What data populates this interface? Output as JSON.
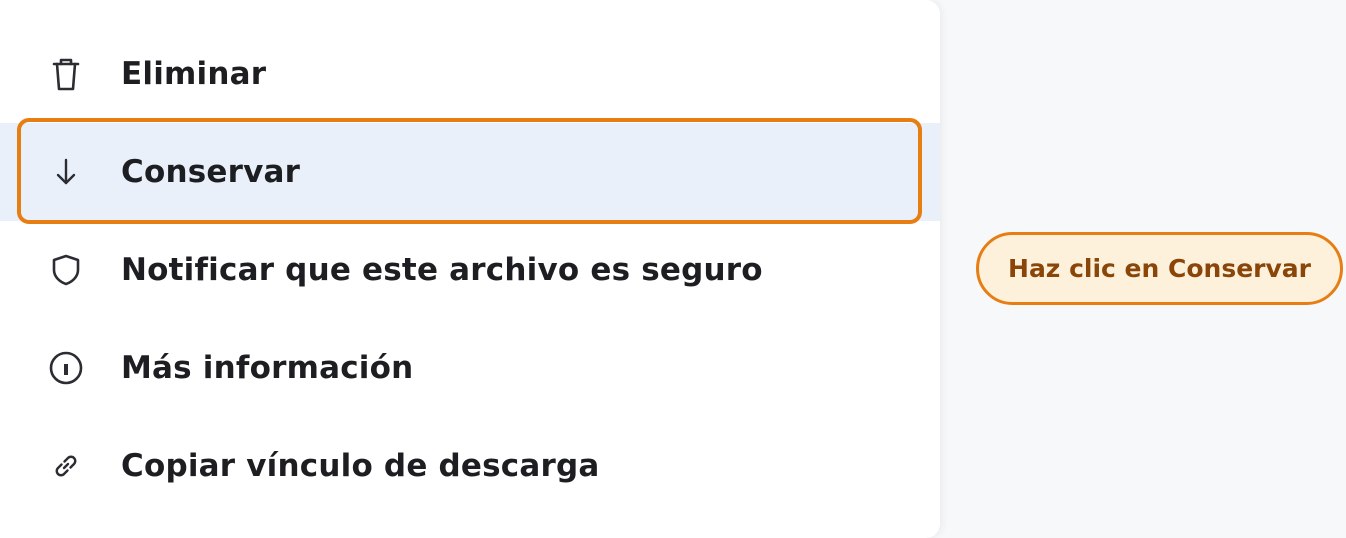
{
  "menu": {
    "items": [
      {
        "icon": "trash-icon",
        "label": "Eliminar"
      },
      {
        "icon": "arrow-down-icon",
        "label": "Conservar"
      },
      {
        "icon": "shield-icon",
        "label": "Notificar que este archivo es seguro"
      },
      {
        "icon": "info-icon",
        "label": "Más información"
      },
      {
        "icon": "link-icon",
        "label": "Copiar vínculo de descarga"
      }
    ],
    "selected_index": 1
  },
  "tooltip": {
    "text": "Haz clic en Conservar"
  },
  "colors": {
    "accent": "#e67e14",
    "selected_bg": "#eaf0fa",
    "tooltip_bg": "#fdf1dc",
    "tooltip_text": "#8a4508",
    "text": "#1d1e22",
    "icon": "#2b2d33"
  }
}
